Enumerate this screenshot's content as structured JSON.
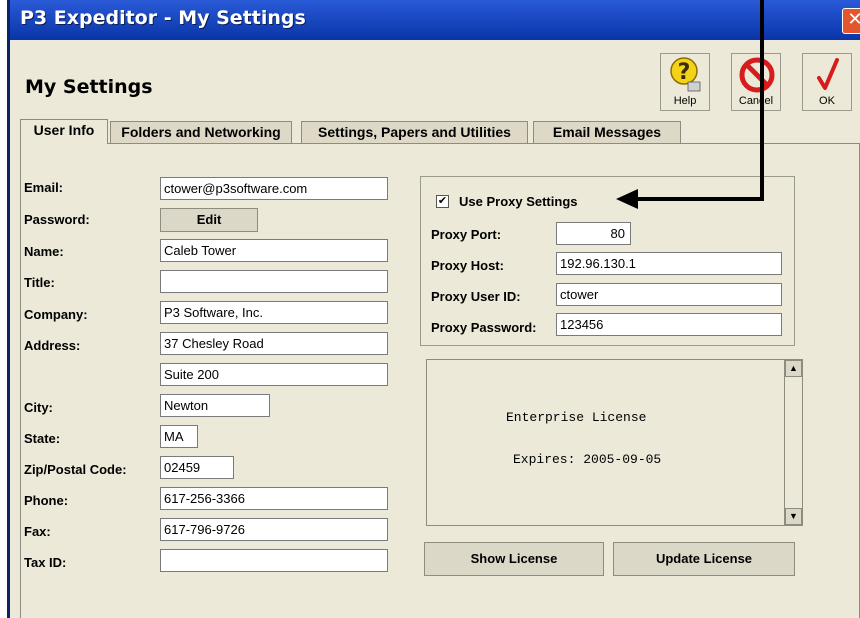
{
  "window": {
    "title": "P3 Expeditor - My Settings",
    "close_symbol": "✕"
  },
  "header": {
    "title": "My Settings",
    "toolbar": {
      "help_label": "Help",
      "cancel_label": "Cancel",
      "ok_label": "OK"
    }
  },
  "tabs": [
    {
      "label": "User Info",
      "active": true
    },
    {
      "label": "Folders and Networking",
      "active": false
    },
    {
      "label": "Settings, Papers and Utilities",
      "active": false
    },
    {
      "label": "Email Messages",
      "active": false
    }
  ],
  "user_info": {
    "email_label": "Email:",
    "email_value": "ctower@p3software.com",
    "password_label": "Password:",
    "password_button": "Edit",
    "name_label": "Name:",
    "name_value": "Caleb Tower",
    "title_label": "Title:",
    "title_value": "",
    "company_label": "Company:",
    "company_value": "P3 Software, Inc.",
    "address_label": "Address:",
    "address_line1": "37 Chesley Road",
    "address_line2": "Suite 200",
    "city_label": "City:",
    "city_value": "Newton",
    "state_label": "State:",
    "state_value": "MA",
    "zip_label": "Zip/Postal Code:",
    "zip_value": "02459",
    "phone_label": "Phone:",
    "phone_value": "617-256-3366",
    "fax_label": "Fax:",
    "fax_value": "617-796-9726",
    "taxid_label": "Tax ID:",
    "taxid_value": ""
  },
  "proxy": {
    "use_proxy_label": "Use Proxy Settings",
    "use_proxy_checked": true,
    "check_mark": "✔",
    "port_label": "Proxy Port:",
    "port_value": "80",
    "host_label": "Proxy Host:",
    "host_value": "192.96.130.1",
    "user_label": "Proxy User ID:",
    "user_value": "ctower",
    "password_label": "Proxy Password:",
    "password_value": "123456"
  },
  "license": {
    "line1": "Enterprise License",
    "line2": "Expires: 2005-09-05",
    "scroll_up": "▲",
    "scroll_down": "▼",
    "show_button": "Show License",
    "update_button": "Update License"
  },
  "colors": {
    "titlebar": "#1c4bc4",
    "window_bg": "#ece9d8",
    "close_button": "#e2552d",
    "help_icon": "#f5d21a",
    "cancel_icon": "#d61c1c",
    "ok_icon": "#d61c1c"
  },
  "icons": {
    "help": "question-mark-icon",
    "cancel": "no-entry-icon",
    "ok": "checkmark-icon",
    "annotation": "callout-arrow-icon"
  }
}
